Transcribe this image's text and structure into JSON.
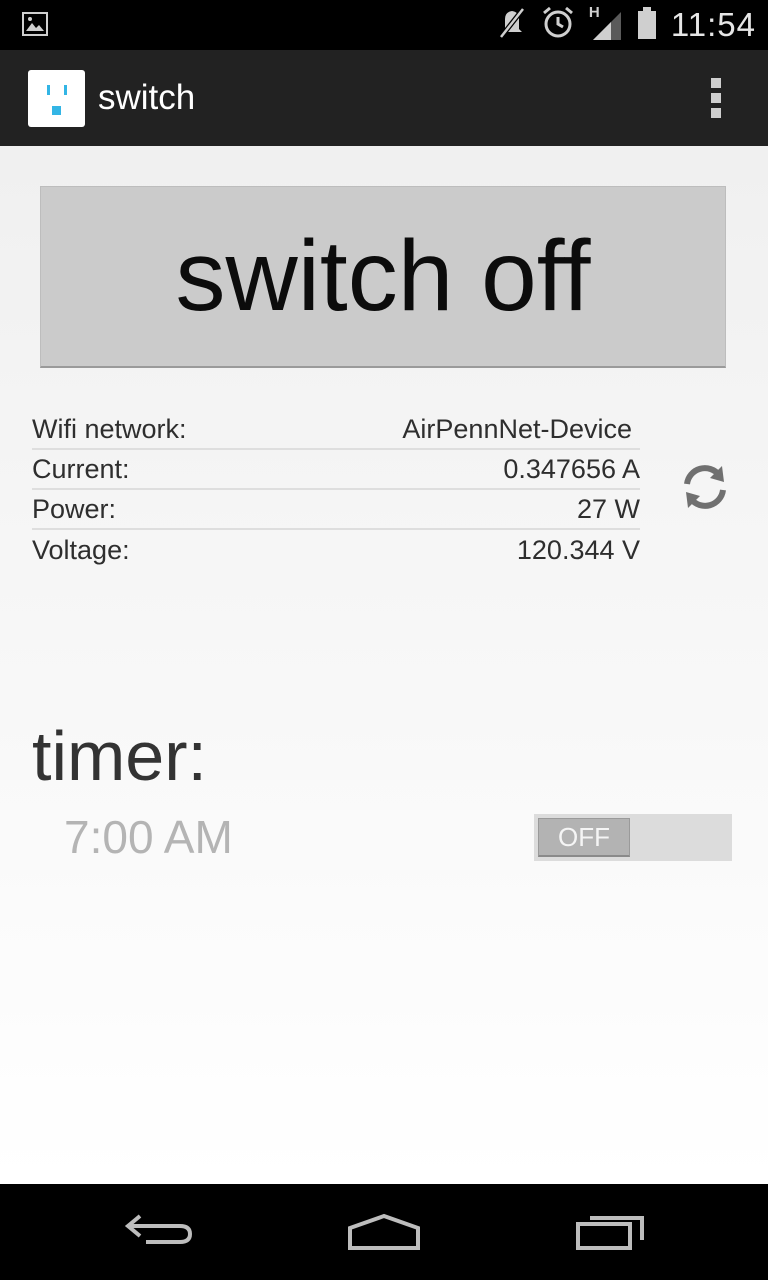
{
  "status_bar": {
    "clock": "11:54",
    "network_type": "H",
    "icons": [
      "picture-notification-icon",
      "muted-icon",
      "alarm-icon",
      "signal-icon",
      "battery-icon"
    ]
  },
  "action_bar": {
    "title": "switch",
    "app_icon": "outlet-icon",
    "overflow_icon": "overflow-menu-icon"
  },
  "main": {
    "switch_button_label": "switch off",
    "info": [
      {
        "label": "Wifi network:",
        "value": "AirPennNet-Device"
      },
      {
        "label": "Current:",
        "value": "0.347656 A"
      },
      {
        "label": "Power:",
        "value": "27 W"
      },
      {
        "label": "Voltage:",
        "value": "120.344 V"
      }
    ],
    "refresh_icon": "refresh-icon",
    "timer": {
      "title": "timer:",
      "time": "7:00 AM",
      "toggle_label": "OFF",
      "toggle_state": false
    }
  },
  "nav_bar": {
    "buttons": [
      "back-icon",
      "home-icon",
      "recent-apps-icon"
    ]
  },
  "colors": {
    "action_bar": "#222222",
    "app_icon_accent": "#33b5e5",
    "button_bg": "#cbcbcb"
  }
}
